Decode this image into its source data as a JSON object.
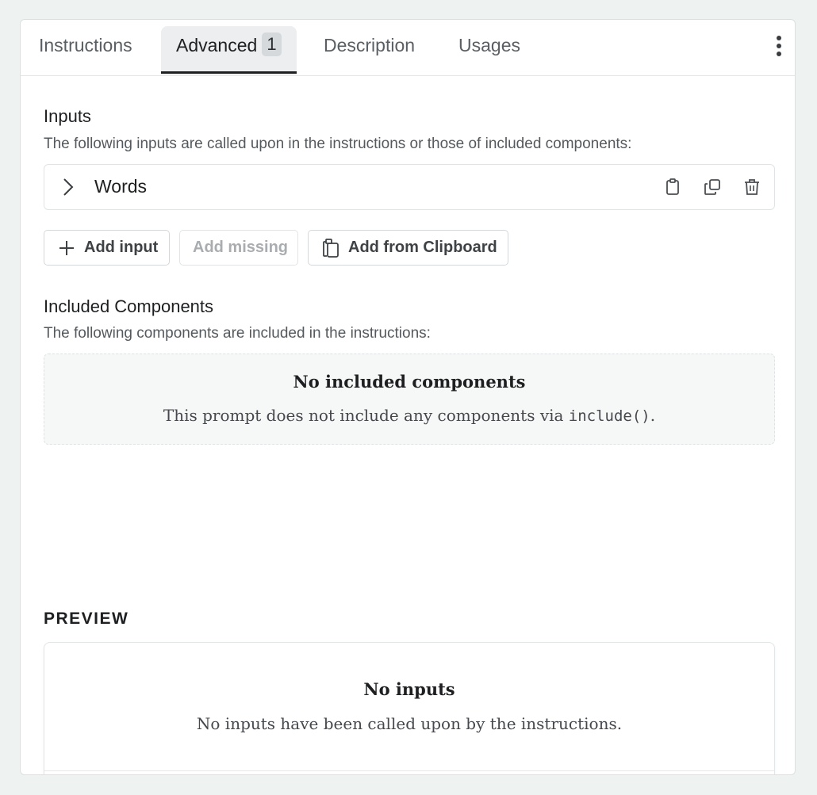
{
  "tabs": [
    {
      "label": "Instructions",
      "active": false
    },
    {
      "label": "Advanced",
      "badge": "1",
      "active": true
    },
    {
      "label": "Description",
      "active": false
    },
    {
      "label": "Usages",
      "active": false
    }
  ],
  "menu_icon": "more-vertical-icon",
  "inputs_section": {
    "title": "Inputs",
    "description": "The following inputs are called upon in the instructions or those of included components:",
    "items": [
      {
        "name": "Words",
        "icons": [
          "chevron-right-icon",
          "clipboard-icon",
          "copy-icon",
          "trash-icon"
        ]
      }
    ],
    "buttons": {
      "add_input": "Add input",
      "add_missing": "Add missing",
      "add_from_clipboard": "Add from Clipboard"
    }
  },
  "components_section": {
    "title": "Included Components",
    "description": "The following components are included in the instructions:",
    "empty_title": "No included components",
    "empty_text_before": "This prompt does not include any components via ",
    "empty_code": "include()",
    "empty_text_after": "."
  },
  "preview": {
    "label": "PREVIEW",
    "empty_title": "No inputs",
    "empty_text": "No inputs have been called upon by the instructions."
  }
}
